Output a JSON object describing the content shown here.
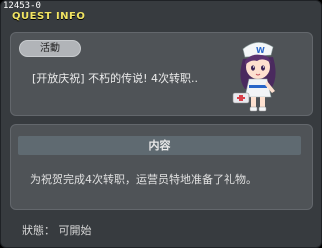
{
  "header": {
    "quest_id": "12453-0",
    "title": "QUEST INFO"
  },
  "quest": {
    "category_tag": "活動",
    "name": "[开放庆祝] 不朽的传说! 4次转职.."
  },
  "content": {
    "header": "内容",
    "description": "为祝贺完成4次转职，运营员特地准备了礼物。"
  },
  "status": {
    "text": "狀態： 可開始"
  },
  "colors": {
    "title": "#f1e463",
    "window_bg": "#373b3f",
    "panel_bg": "#4f5357"
  },
  "npc": {
    "icon": "npc-nurse-character-icon"
  }
}
